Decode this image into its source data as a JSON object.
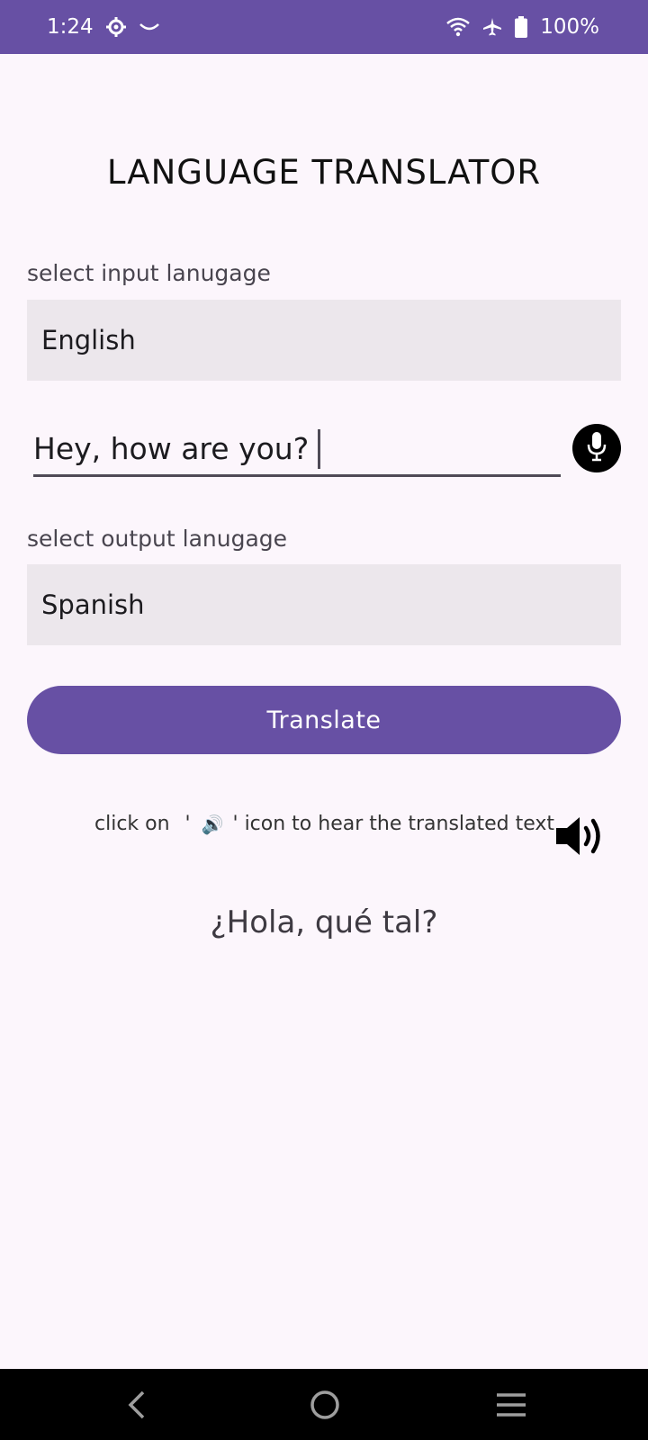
{
  "status_bar": {
    "time": "1:24",
    "battery_percent": "100%",
    "icons": [
      "settings-gear-icon",
      "cloud-icon",
      "wifi-icon",
      "airplane-icon",
      "battery-icon"
    ]
  },
  "app": {
    "title": "LANGUAGE TRANSLATOR"
  },
  "input_language": {
    "label": "select input lanugage",
    "selected": "English"
  },
  "text_input": {
    "value": "Hey, how are you?"
  },
  "output_language": {
    "label": "select output lanugage",
    "selected": "Spanish"
  },
  "translate_button": {
    "label": "Translate"
  },
  "hint": {
    "prefix": "click on ",
    "quote_open": "'",
    "emoji": "🔊",
    "quote_close": "'",
    "suffix": " icon to hear the translated text"
  },
  "output": {
    "text": "¿Hola, qué tal?"
  },
  "colors": {
    "primary": "#6750A4",
    "background": "#FCF6FC",
    "field": "#ECE7EC"
  }
}
